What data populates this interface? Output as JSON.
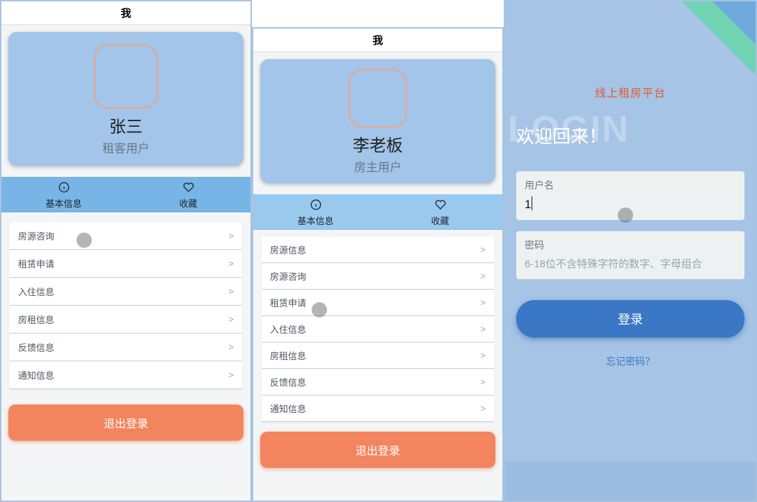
{
  "panelA": {
    "title": "我",
    "user_name": "张三",
    "user_role": "租客用户",
    "quick": {
      "info_label": "基本信息",
      "fav_label": "收藏"
    },
    "menu": [
      {
        "label": "房源咨询"
      },
      {
        "label": "租赁申请"
      },
      {
        "label": "入住信息"
      },
      {
        "label": "房租信息"
      },
      {
        "label": "反馈信息"
      },
      {
        "label": "通知信息"
      }
    ],
    "logout": "退出登录"
  },
  "panelB": {
    "title": "我",
    "user_name": "李老板",
    "user_role": "房主用户",
    "quick": {
      "info_label": "基本信息",
      "fav_label": "收藏"
    },
    "menu": [
      {
        "label": "房源信息"
      },
      {
        "label": "房源咨询"
      },
      {
        "label": "租赁申请"
      },
      {
        "label": "入住信息"
      },
      {
        "label": "房租信息"
      },
      {
        "label": "反馈信息"
      },
      {
        "label": "通知信息"
      }
    ],
    "logout": "退出登录"
  },
  "panelC": {
    "brand": "线上租房平台",
    "ghost": "LOGIN",
    "welcome": "欢迎回来！",
    "username_label": "用户名",
    "username_value": "1",
    "password_label": "密码",
    "password_placeholder": "6-18位不含特殊字符的数字、字母组合",
    "login_btn": "登录",
    "forgot": "忘记密码？"
  },
  "chevron": ">"
}
